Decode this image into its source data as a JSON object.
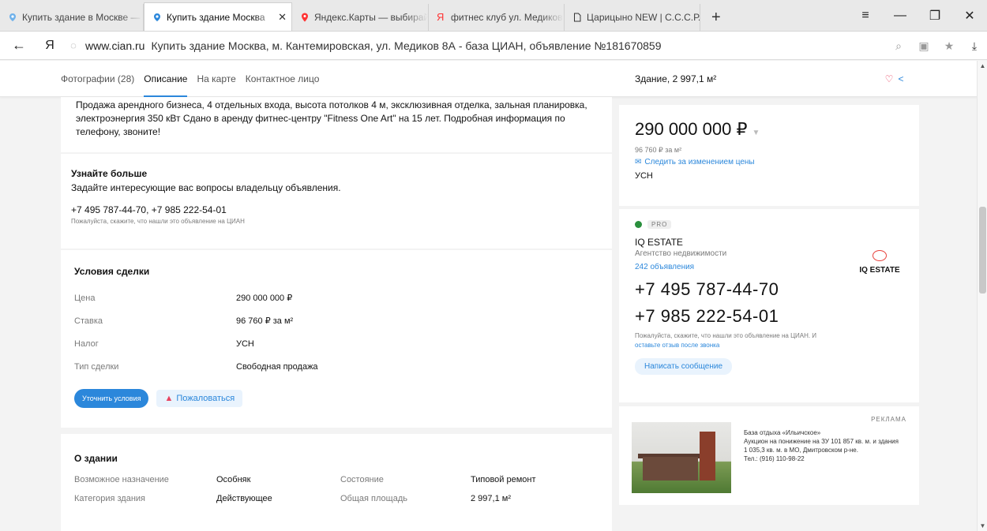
{
  "browser": {
    "tabs": [
      {
        "label": "Купить здание в Москве —",
        "icon": "cian-icon"
      },
      {
        "label": "Купить здание Москва",
        "icon": "cian-icon",
        "active": true
      },
      {
        "label": "Яндекс.Карты — выбирай",
        "icon": "yandex-maps-icon"
      },
      {
        "label": "фитнес клуб ул. Медиков",
        "icon": "yandex-icon"
      },
      {
        "label": "Царицыно NEW | С.С.С.Р.",
        "icon": "page-icon"
      }
    ],
    "new_tab": "+",
    "window_controls": [
      "≡",
      "—",
      "❐",
      "✕"
    ],
    "url_domain": "www.cian.ru",
    "page_title": "Купить здание Москва, м. Кантемировская, ул. Медиков 8А - база ЦИАН, объявление №181670859",
    "back": "←",
    "ylogo": "Я"
  },
  "nav": {
    "links": [
      "Фотографии (28)",
      "Описание",
      "На карте",
      "Контактное лицо"
    ],
    "summary": "Здание, 2 997,1 м²"
  },
  "description": {
    "text": "Продажа арендного бизнеса, 4 отдельных входа, высота потолков 4 м, эксклюзивная отделка, зальная планировка, электроэнергия 350 кВт Сдано в аренду фитнес-центру \"Fitness One Art\" на 15 лет. Подробная информация по телефону, звоните!"
  },
  "more": {
    "title": "Узнайте больше",
    "question": "Задайте интересующие вас вопросы владельцу объявления.",
    "phones": "+7 495 787-44-70, +7 985 222-54-01",
    "note": "Пожалуйста, скажите, что нашли это объявление на ЦИАН"
  },
  "deal": {
    "title": "Условия сделки",
    "rows": [
      {
        "k": "Цена",
        "v": "290 000 000 ₽"
      },
      {
        "k": "Ставка",
        "v": "96 760 ₽ за м²"
      },
      {
        "k": "Налог",
        "v": "УСН"
      },
      {
        "k": "Тип сделки",
        "v": "Свободная продажа"
      }
    ],
    "btn_clarify": "Уточнить условия",
    "btn_complain": "Пожаловаться"
  },
  "building": {
    "title": "О здании",
    "rows": [
      {
        "k1": "Возможное назначение",
        "v1": "Особняк",
        "k2": "Состояние",
        "v2": "Типовой ремонт"
      },
      {
        "k1": "Категория здания",
        "v1": "Действующее",
        "k2": "Общая площадь",
        "v2": "2 997,1 м²"
      }
    ]
  },
  "price": {
    "amount": "290 000 000 ₽",
    "per_m": "96 760 ₽ за м²",
    "follow": "Следить за изменением цены",
    "tax": "УСН"
  },
  "agent": {
    "pro": "PRO",
    "name": "IQ ESTATE",
    "type": "Агентство недвижимости",
    "count": "242 объявления",
    "logo_text": "IQ ESTATE",
    "phone1": "+7 495 787-44-70",
    "phone2": "+7 985 222-54-01",
    "note_a": "Пожалуйста, скажите, что нашли это объявление на ЦИАН. И ",
    "note_link": "оставьте отзыв после звонка",
    "message_btn": "Написать сообщение"
  },
  "ad": {
    "label": "РЕКЛАМА",
    "title": "База отдыха «Ильичское»",
    "text": "Аукцион на понижение на ЗУ 101 857 кв. м. и здания 1 035,3 кв. м. в МО, Дмитровском р-не.",
    "phone": "Тел.: (916) 110-98-22"
  },
  "colors": {
    "accent": "#2b87db",
    "heart": "#e84260",
    "pro_check": "#2a8f3d"
  }
}
